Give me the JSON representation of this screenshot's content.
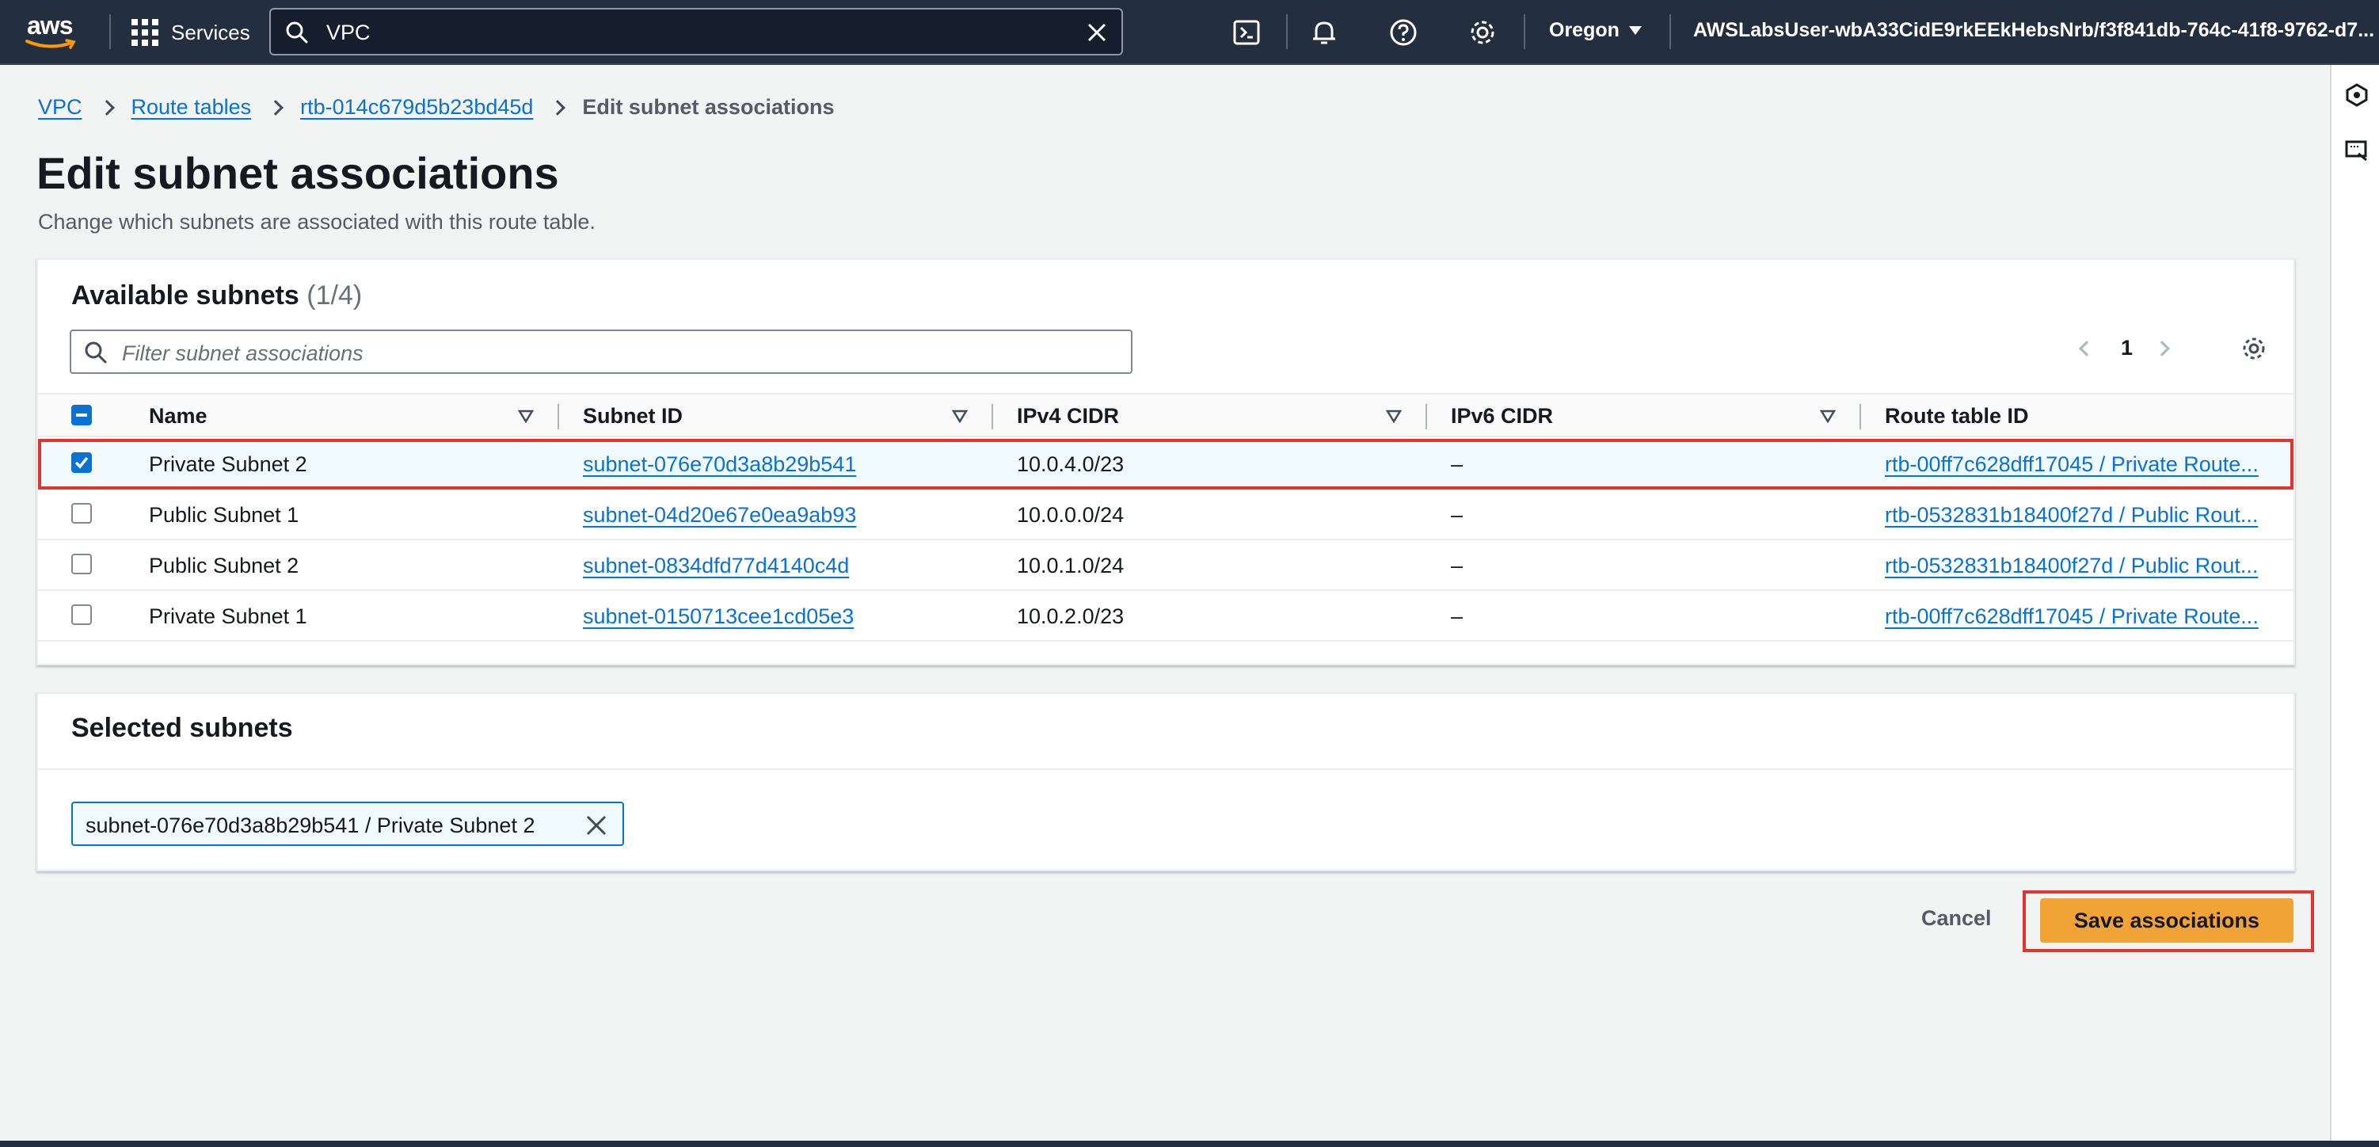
{
  "topnav": {
    "logo_text": "aws",
    "services_label": "Services",
    "search_value": "VPC",
    "region": "Oregon",
    "account": "AWSLabsUser-wbA33CidE9rkEEkHebsNrb/f3f841db-764c-41f8-9762-d7..."
  },
  "breadcrumb": {
    "items": [
      "VPC",
      "Route tables",
      "rtb-014c679d5b23bd45d"
    ],
    "current": "Edit subnet associations"
  },
  "page": {
    "title": "Edit subnet associations",
    "description": "Change which subnets are associated with this route table."
  },
  "available": {
    "title": "Available subnets",
    "count": "(1/4)",
    "filter_placeholder": "Filter subnet associations",
    "page_number": "1",
    "columns": [
      "Name",
      "Subnet ID",
      "IPv4 CIDR",
      "IPv6 CIDR",
      "Route table ID"
    ],
    "rows": [
      {
        "name": "Private Subnet 2",
        "subnet_id": "subnet-076e70d3a8b29b541",
        "ipv4": "10.0.4.0/23",
        "ipv6": "–",
        "route_table": "rtb-00ff7c628dff17045 / Private Route...",
        "checked": true
      },
      {
        "name": "Public Subnet 1",
        "subnet_id": "subnet-04d20e67e0ea9ab93",
        "ipv4": "10.0.0.0/24",
        "ipv6": "–",
        "route_table": "rtb-0532831b18400f27d / Public Rout...",
        "checked": false
      },
      {
        "name": "Public Subnet 2",
        "subnet_id": "subnet-0834dfd77d4140c4d",
        "ipv4": "10.0.1.0/24",
        "ipv6": "–",
        "route_table": "rtb-0532831b18400f27d / Public Rout...",
        "checked": false
      },
      {
        "name": "Private Subnet 1",
        "subnet_id": "subnet-0150713cee1cd05e3",
        "ipv4": "10.0.2.0/23",
        "ipv6": "–",
        "route_table": "rtb-00ff7c628dff17045 / Private Route...",
        "checked": false
      }
    ]
  },
  "selected": {
    "title": "Selected subnets",
    "token": "subnet-076e70d3a8b29b541 / Private Subnet 2"
  },
  "actions": {
    "cancel": "Cancel",
    "save": "Save associations"
  },
  "colors": {
    "nav_bg": "#232f3e",
    "link": "#0972d3",
    "primary_button": "#f2a336",
    "highlight_outline": "#e0362d"
  }
}
